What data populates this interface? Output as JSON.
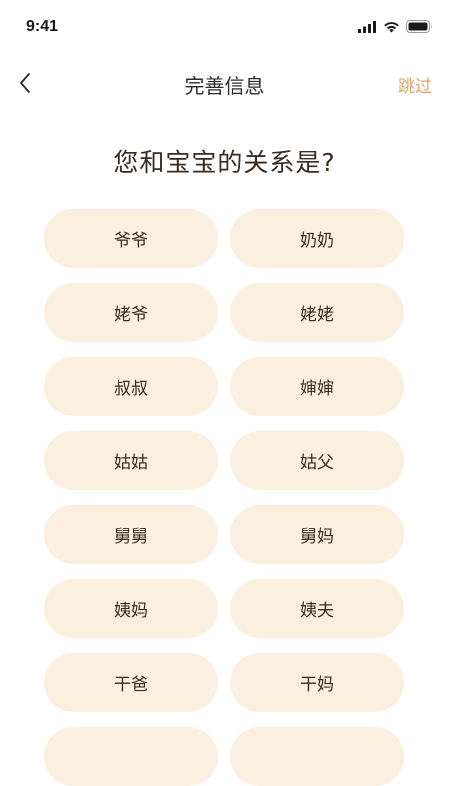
{
  "status_bar": {
    "time": "9:41"
  },
  "nav": {
    "title": "完善信息",
    "skip_label": "跳过"
  },
  "question": "您和宝宝的关系是?",
  "colors": {
    "option_bg": "#fbefdf",
    "skip_accent": "#d4a96a",
    "text": "#3b2a1f"
  },
  "options": [
    {
      "label": "爷爷"
    },
    {
      "label": "奶奶"
    },
    {
      "label": "姥爷"
    },
    {
      "label": "姥姥"
    },
    {
      "label": "叔叔"
    },
    {
      "label": "婶婶"
    },
    {
      "label": "姑姑"
    },
    {
      "label": "姑父"
    },
    {
      "label": "舅舅"
    },
    {
      "label": "舅妈"
    },
    {
      "label": "姨妈"
    },
    {
      "label": "姨夫"
    },
    {
      "label": "干爸"
    },
    {
      "label": "干妈"
    },
    {
      "label": ""
    },
    {
      "label": ""
    }
  ]
}
